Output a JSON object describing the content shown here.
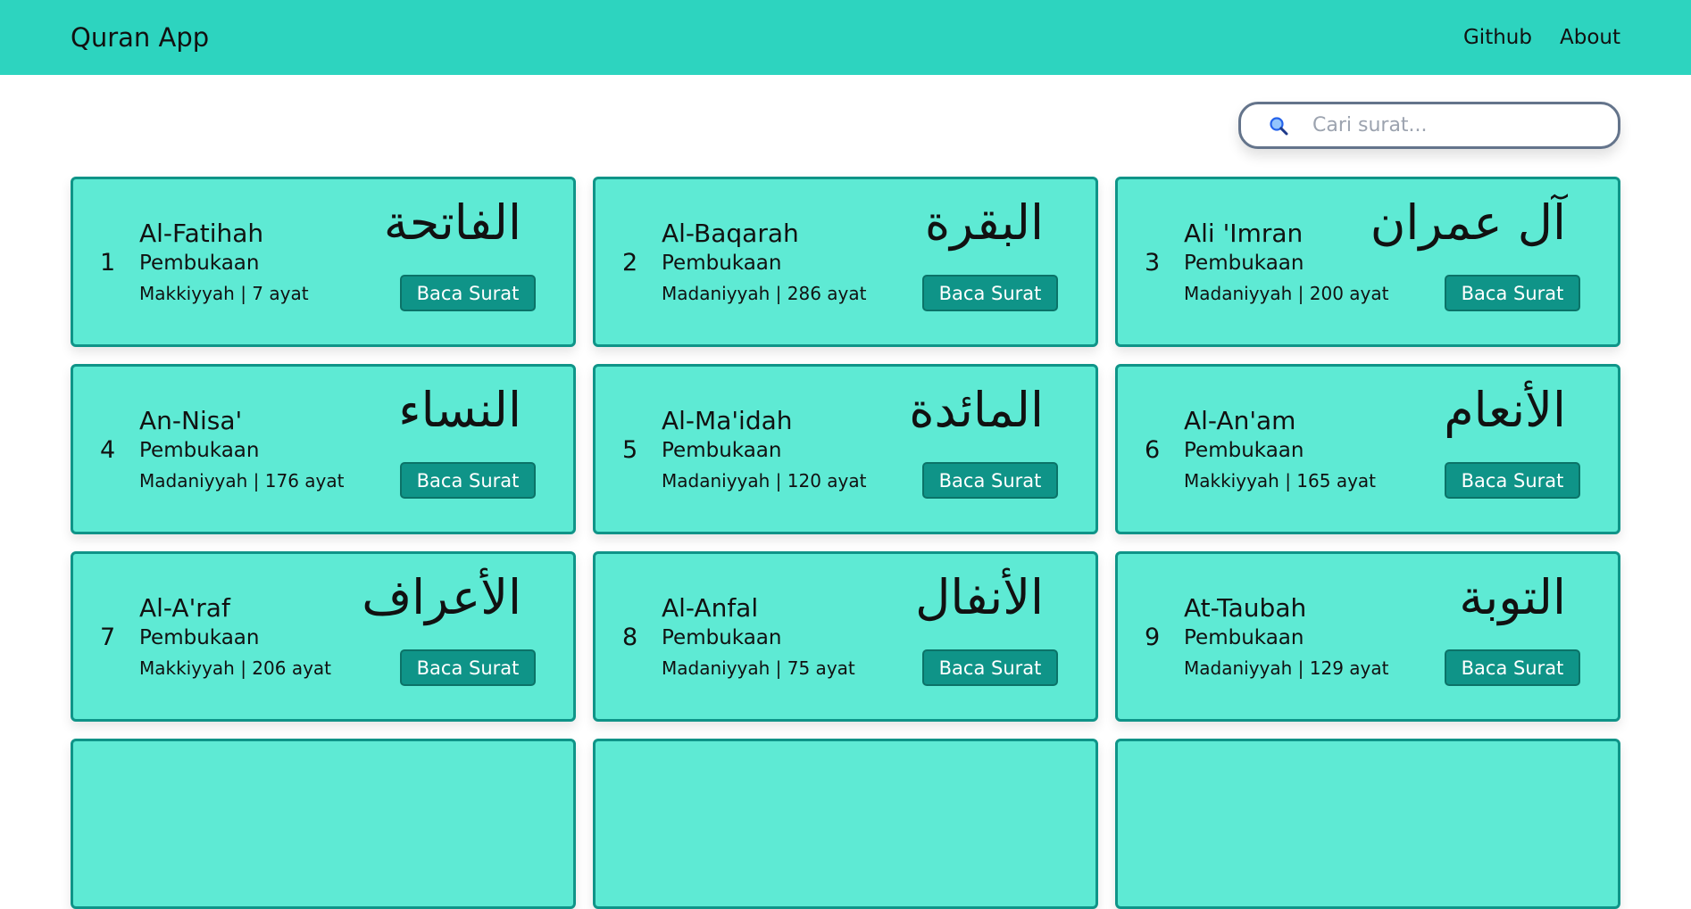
{
  "navbar": {
    "brand": "Quran App",
    "links": [
      "Github",
      "About"
    ]
  },
  "search": {
    "placeholder": "Cari surat..."
  },
  "surahs": [
    {
      "number": "1",
      "name": "Al-Fatihah",
      "meaning": "Pembukaan",
      "meta": "Makkiyyah | 7 ayat",
      "arabic": "الفاتحة",
      "button": "Baca Surat"
    },
    {
      "number": "2",
      "name": "Al-Baqarah",
      "meaning": "Pembukaan",
      "meta": "Madaniyyah | 286 ayat",
      "arabic": "البقرة",
      "button": "Baca Surat"
    },
    {
      "number": "3",
      "name": "Ali 'Imran",
      "meaning": "Pembukaan",
      "meta": "Madaniyyah | 200 ayat",
      "arabic": "آل عمران",
      "button": "Baca Surat"
    },
    {
      "number": "4",
      "name": "An-Nisa'",
      "meaning": "Pembukaan",
      "meta": "Madaniyyah | 176 ayat",
      "arabic": "النساء",
      "button": "Baca Surat"
    },
    {
      "number": "5",
      "name": "Al-Ma'idah",
      "meaning": "Pembukaan",
      "meta": "Madaniyyah | 120 ayat",
      "arabic": "المائدة",
      "button": "Baca Surat"
    },
    {
      "number": "6",
      "name": "Al-An'am",
      "meaning": "Pembukaan",
      "meta": "Makkiyyah | 165 ayat",
      "arabic": "الأنعام",
      "button": "Baca Surat"
    },
    {
      "number": "7",
      "name": "Al-A'raf",
      "meaning": "Pembukaan",
      "meta": "Makkiyyah | 206 ayat",
      "arabic": "الأعراف",
      "button": "Baca Surat"
    },
    {
      "number": "8",
      "name": "Al-Anfal",
      "meaning": "Pembukaan",
      "meta": "Madaniyyah | 75 ayat",
      "arabic": "الأنفال",
      "button": "Baca Surat"
    },
    {
      "number": "9",
      "name": "At-Taubah",
      "meaning": "Pembukaan",
      "meta": "Madaniyyah | 129 ayat",
      "arabic": "التوبة",
      "button": "Baca Surat"
    },
    {
      "number": "",
      "name": "",
      "meaning": "",
      "meta": "",
      "arabic": "",
      "button": ""
    },
    {
      "number": "",
      "name": "",
      "meaning": "",
      "meta": "",
      "arabic": "",
      "button": ""
    },
    {
      "number": "",
      "name": "",
      "meaning": "",
      "meta": "",
      "arabic": "",
      "button": ""
    }
  ]
}
